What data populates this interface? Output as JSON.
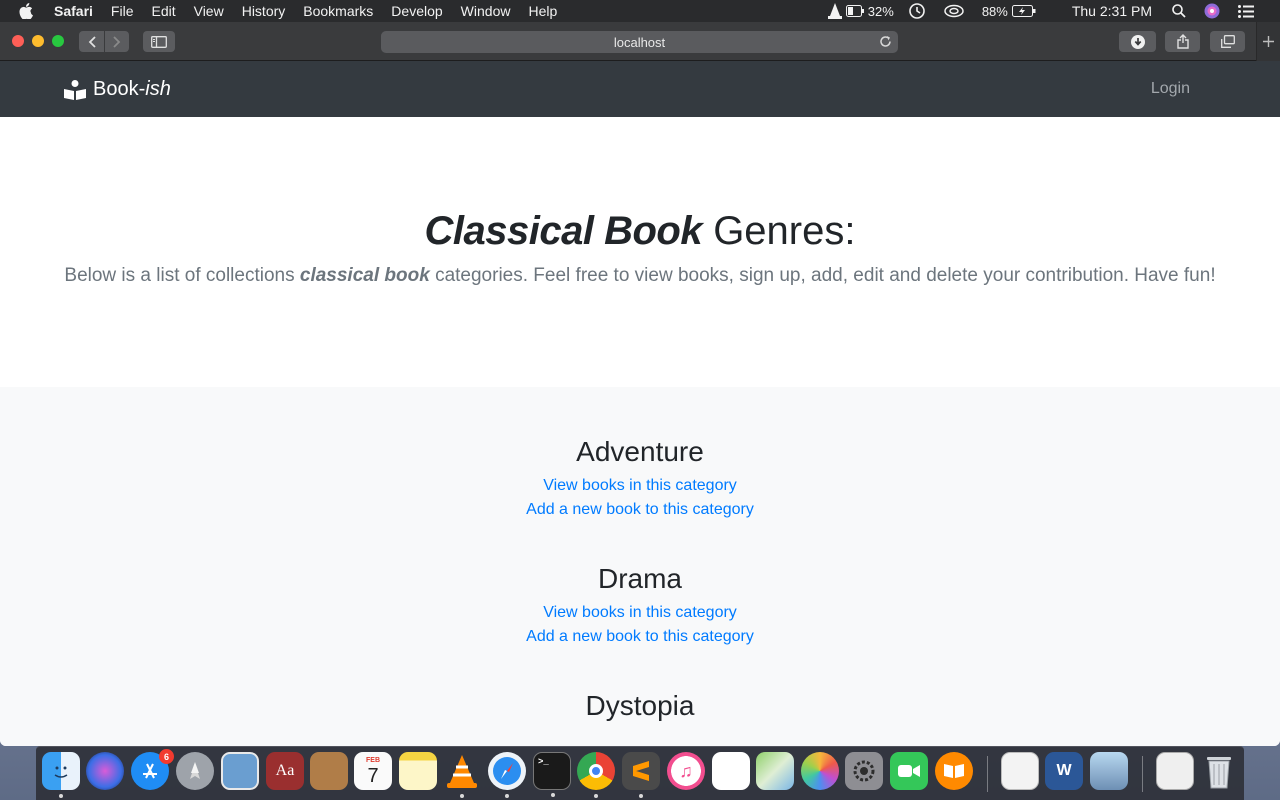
{
  "menubar": {
    "app_name": "Safari",
    "items": [
      "File",
      "Edit",
      "View",
      "History",
      "Bookmarks",
      "Develop",
      "Window",
      "Help"
    ],
    "vlc_battery": "32%",
    "battery": "88%",
    "clock": "Thu 2:31 PM"
  },
  "browser": {
    "address": "localhost"
  },
  "site": {
    "brand_main": "Book-",
    "brand_italic": "ish",
    "login_label": "Login"
  },
  "hero": {
    "title_em": "Classical Book",
    "title_rest": " Genres:",
    "desc_start": "Below is a list of collections ",
    "desc_em": "classical book",
    "desc_end": " categories. Feel free to view books, sign up, add, edit and delete your contribution. Have fun!"
  },
  "genres": [
    {
      "name": "Adventure",
      "view_link": "View books in this category",
      "add_link": "Add a new book to this category"
    },
    {
      "name": "Drama",
      "view_link": "View books in this category",
      "add_link": "Add a new book to this category"
    },
    {
      "name": "Dystopia"
    }
  ],
  "dock": {
    "app_store_badge": "6",
    "calendar_month": "FEB",
    "calendar_day": "7",
    "apps": [
      "finder-icon",
      "siri-icon",
      "app-store-icon",
      "launchpad-icon",
      "preview-icon",
      "dictionary-icon",
      "contacts-icon",
      "calendar-icon",
      "notes-icon",
      "vlc-icon",
      "safari-icon",
      "terminal-icon",
      "chrome-icon",
      "sublime-icon",
      "itunes-icon",
      "reminders-icon",
      "maps-icon",
      "photos-icon",
      "system-preferences-icon",
      "facetime-icon",
      "ibooks-icon",
      "textedit-icon",
      "word-icon",
      "image-capture-icon",
      "downloads-stack-icon",
      "trash-icon"
    ]
  },
  "colors": {
    "navbar": "#343a40",
    "link": "#007bff",
    "muted_text": "#6c757d",
    "section_bg": "#f8f9fa"
  }
}
